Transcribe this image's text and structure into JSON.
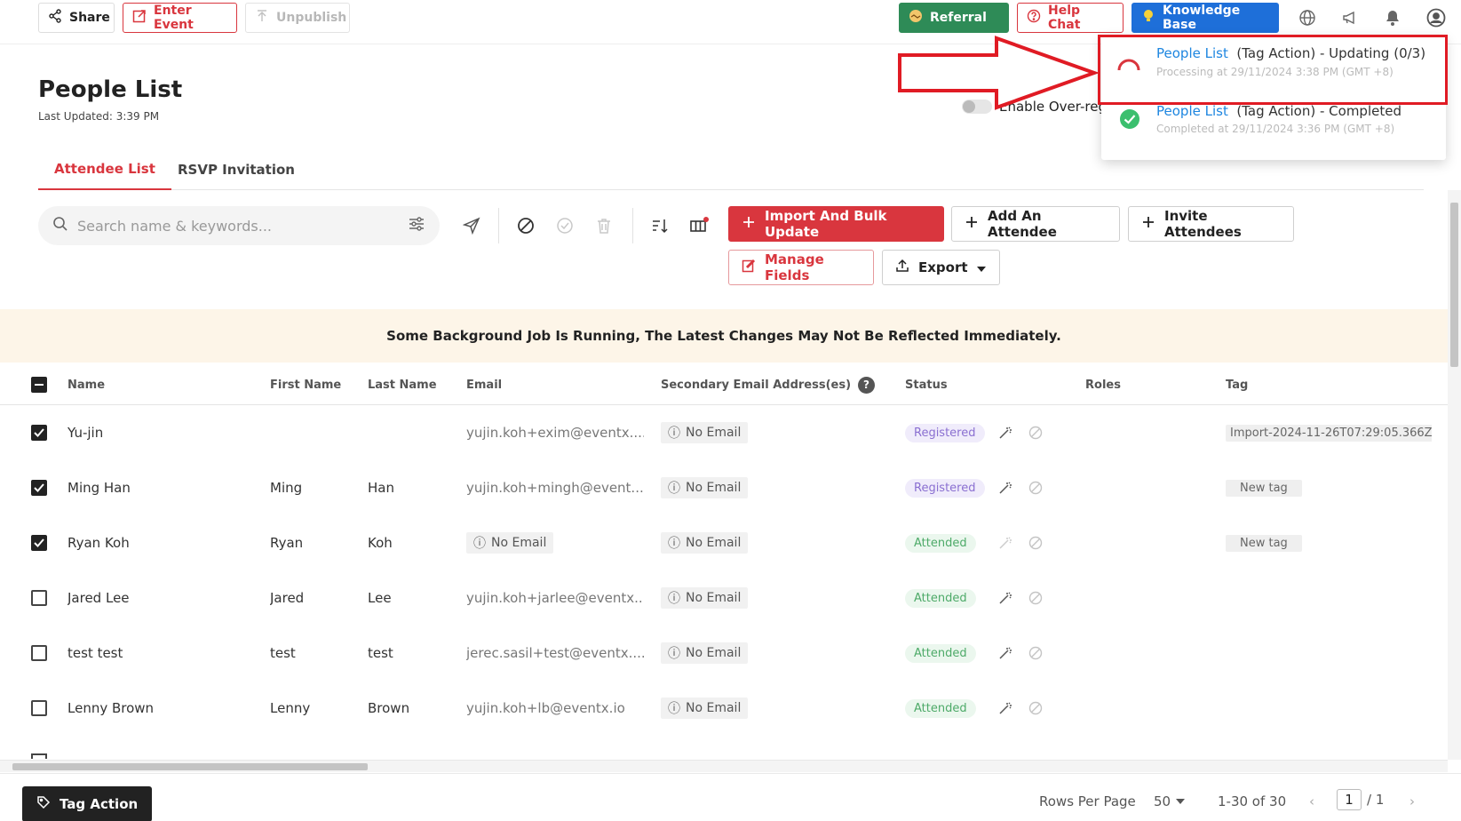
{
  "topbar": {
    "share": "Share",
    "enter_event": "Enter Event",
    "unpublish": "Unpublish",
    "referral": "Referral",
    "help_chat": "Help Chat",
    "knowledge_base": "Knowledge Base"
  },
  "page": {
    "title": "People List",
    "last_updated": "Last Updated: 3:39 PM",
    "tabs": [
      "Attendee List",
      "RSVP Invitation"
    ],
    "over_registration": "Enable Over-reg"
  },
  "toolbar": {
    "search_placeholder": "Search name & keywords...",
    "import_bulk": "Import And Bulk Update",
    "add_attendee": "Add An Attendee",
    "invite_attendees": "Invite Attendees",
    "manage_fields": "Manage Fields",
    "export": "Export"
  },
  "banner": "Some Background Job Is Running, The Latest Changes May Not Be Reflected Immediately.",
  "table": {
    "headers": {
      "name": "Name",
      "first_name": "First Name",
      "last_name": "Last Name",
      "email": "Email",
      "secondary_email": "Secondary Email Address(es)",
      "status": "Status",
      "roles": "Roles",
      "tag": "Tag"
    },
    "rows": [
      {
        "checked": true,
        "name": "Yu-jin",
        "first": "",
        "last": "",
        "email": "yujin.koh+exim@eventx....",
        "secondary": "No Email",
        "status": "Registered",
        "tag": "Import-2024-11-26T07:29:05.366Z"
      },
      {
        "checked": true,
        "name": "Ming Han",
        "first": "Ming",
        "last": "Han",
        "email": "yujin.koh+mingh@event...",
        "secondary": "No Email",
        "status": "Registered",
        "tag": "New tag"
      },
      {
        "checked": true,
        "name": "Ryan Koh",
        "first": "Ryan",
        "last": "Koh",
        "email": "No Email",
        "secondary": "No Email",
        "status": "Attended",
        "tag": "New tag"
      },
      {
        "checked": false,
        "name": "Jared Lee",
        "first": "Jared",
        "last": "Lee",
        "email": "yujin.koh+jarlee@eventx...",
        "secondary": "No Email",
        "status": "Attended",
        "tag": ""
      },
      {
        "checked": false,
        "name": "test test",
        "first": "test",
        "last": "test",
        "email": "jerec.sasil+test@eventx....",
        "secondary": "No Email",
        "status": "Attended",
        "tag": ""
      },
      {
        "checked": false,
        "name": "Lenny Brown",
        "first": "Lenny",
        "last": "Brown",
        "email": "yujin.koh+lb@eventx.io",
        "secondary": "No Email",
        "status": "Attended",
        "tag": ""
      }
    ]
  },
  "footer": {
    "tag_action": "Tag Action",
    "rows_per_page_label": "Rows Per Page",
    "rows_per_page": "50",
    "range": "1-30 of 30",
    "page": "1",
    "total_pages": "/ 1"
  },
  "jobs": [
    {
      "link": "People List",
      "action": "(Tag Action)  -  Updating (0/3)",
      "sub": "Processing at 29/11/2024 3:38 PM (GMT +8)",
      "state": "processing"
    },
    {
      "link": "People List",
      "action": "(Tag Action)  -  Completed",
      "sub": "Completed at 29/11/2024 3:36 PM (GMT +8)",
      "state": "completed"
    }
  ],
  "colors": {
    "accent": "#d9363e",
    "link": "#1e86e0",
    "highlight": "#e01b24"
  }
}
